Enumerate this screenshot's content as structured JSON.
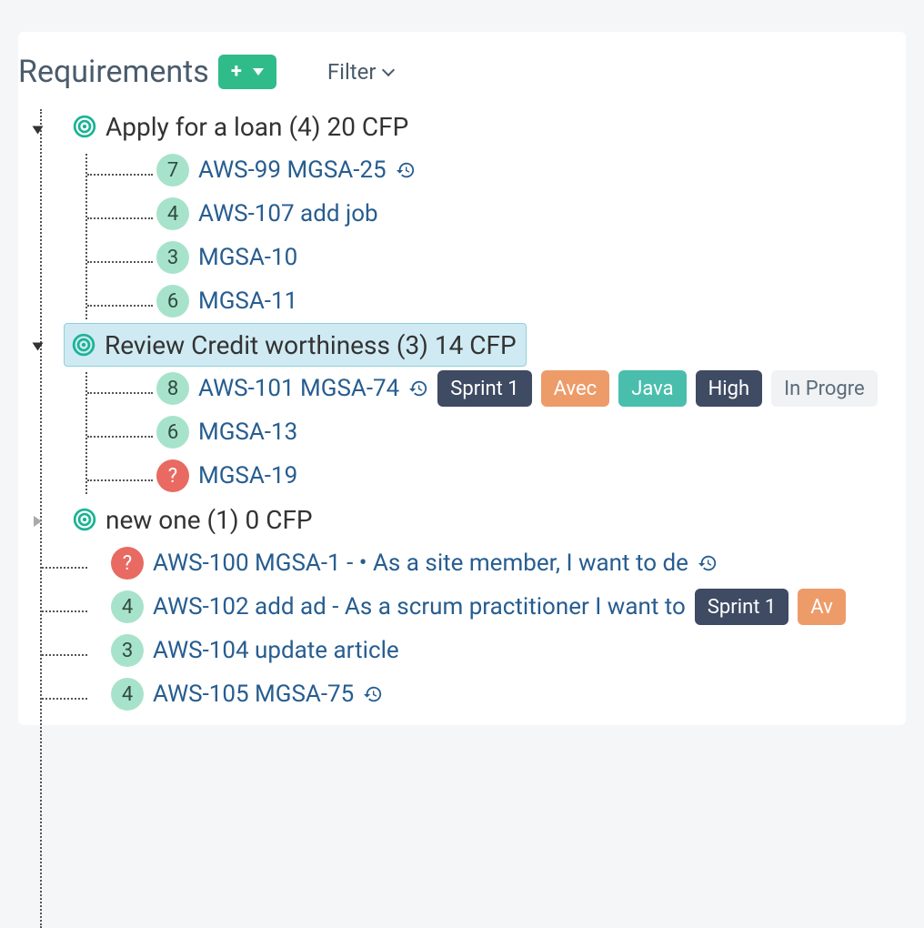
{
  "header": {
    "title": "Requirements",
    "filter_label": "Filter"
  },
  "groups": [
    {
      "label": "Apply for a loan (4) 20 CFP",
      "expanded": true,
      "items": [
        {
          "badge": "7",
          "badge_color": "green",
          "label": "AWS-99 MGSA-25",
          "history": true
        },
        {
          "badge": "4",
          "badge_color": "green",
          "label": "AWS-107 add job",
          "history": false
        },
        {
          "badge": "3",
          "badge_color": "green",
          "label": "MGSA-10",
          "history": false
        },
        {
          "badge": "6",
          "badge_color": "green",
          "label": "MGSA-11",
          "history": false
        }
      ]
    },
    {
      "label": "Review Credit worthiness (3) 14 CFP",
      "selected": true,
      "expanded": true,
      "items": [
        {
          "badge": "8",
          "badge_color": "green",
          "label": "AWS-101 MGSA-74",
          "history": true,
          "tags": [
            {
              "text": "Sprint 1",
              "cls": "sprint"
            },
            {
              "text": "Avec",
              "cls": "avec"
            },
            {
              "text": "Java",
              "cls": "java"
            },
            {
              "text": "High",
              "cls": "high"
            },
            {
              "text": "In Progre",
              "cls": "status"
            }
          ]
        },
        {
          "badge": "6",
          "badge_color": "green",
          "label": "MGSA-13",
          "history": false
        },
        {
          "badge": "?",
          "badge_color": "red",
          "label": "MGSA-19",
          "history": false
        }
      ]
    },
    {
      "label": "new one (1) 0 CFP",
      "expanded": false,
      "items": []
    }
  ],
  "flat_items": [
    {
      "badge": "?",
      "badge_color": "red",
      "label": "AWS-100 MGSA-1 - • As a site member, I want to de",
      "history": true
    },
    {
      "badge": "4",
      "badge_color": "green",
      "label": "AWS-102 add ad - As a scrum practitioner I want to",
      "history": false,
      "tags": [
        {
          "text": "Sprint 1",
          "cls": "sprint"
        },
        {
          "text": "Av",
          "cls": "avec"
        }
      ]
    },
    {
      "badge": "3",
      "badge_color": "green",
      "label": "AWS-104 update article",
      "history": false
    },
    {
      "badge": "4",
      "badge_color": "green",
      "label": "AWS-105 MGSA-75",
      "history": true
    }
  ]
}
